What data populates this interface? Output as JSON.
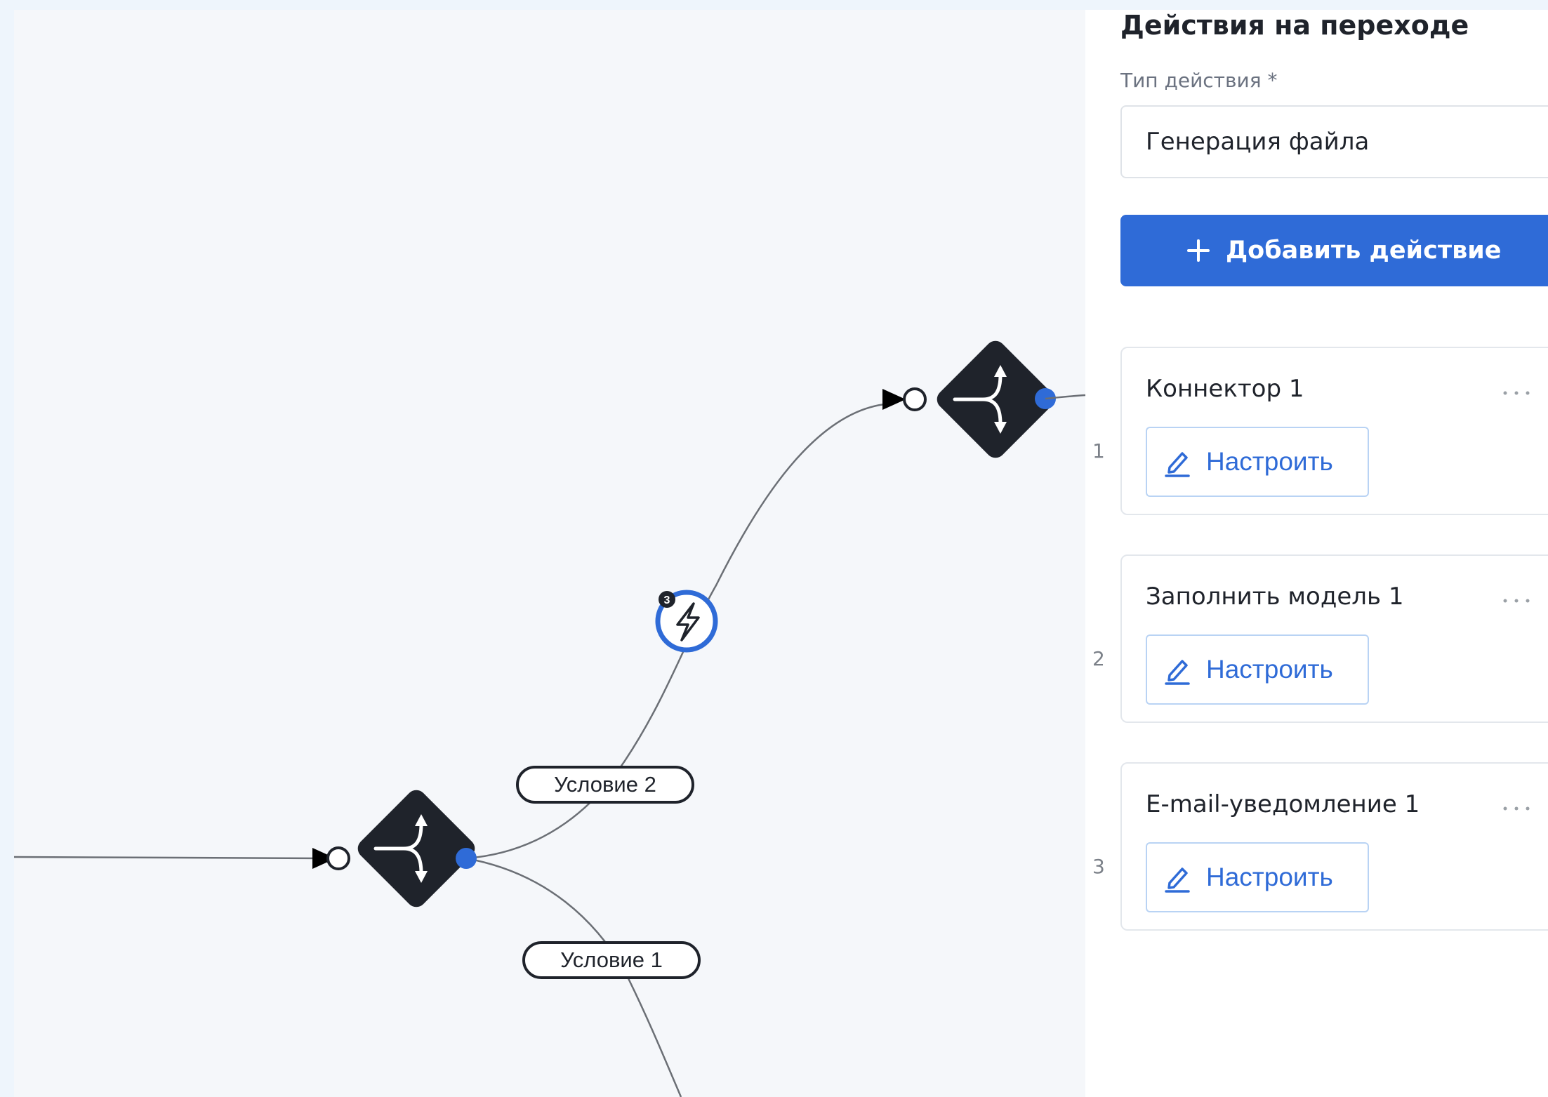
{
  "canvas": {
    "conditions": [
      {
        "label": "Условие 2"
      },
      {
        "label": "Условие 1"
      }
    ],
    "event_badge_count": "3"
  },
  "panel": {
    "title": "Действия на переходе",
    "action_type_label": "Тип действия *",
    "action_type_value": "Генерация файла",
    "add_button_label": "Добавить действие",
    "actions": [
      {
        "index": "1",
        "name": "Коннектор 1",
        "configure_label": "Настроить"
      },
      {
        "index": "2",
        "name": "Заполнить модель 1",
        "configure_label": "Настроить"
      },
      {
        "index": "3",
        "name": "E-mail-уведомление 1",
        "configure_label": "Настроить"
      }
    ]
  },
  "colors": {
    "accent": "#2f6bd7",
    "node_dark": "#1f232b",
    "canvas_bg": "#f5f7fa",
    "panel_bg": "#ffffff"
  }
}
